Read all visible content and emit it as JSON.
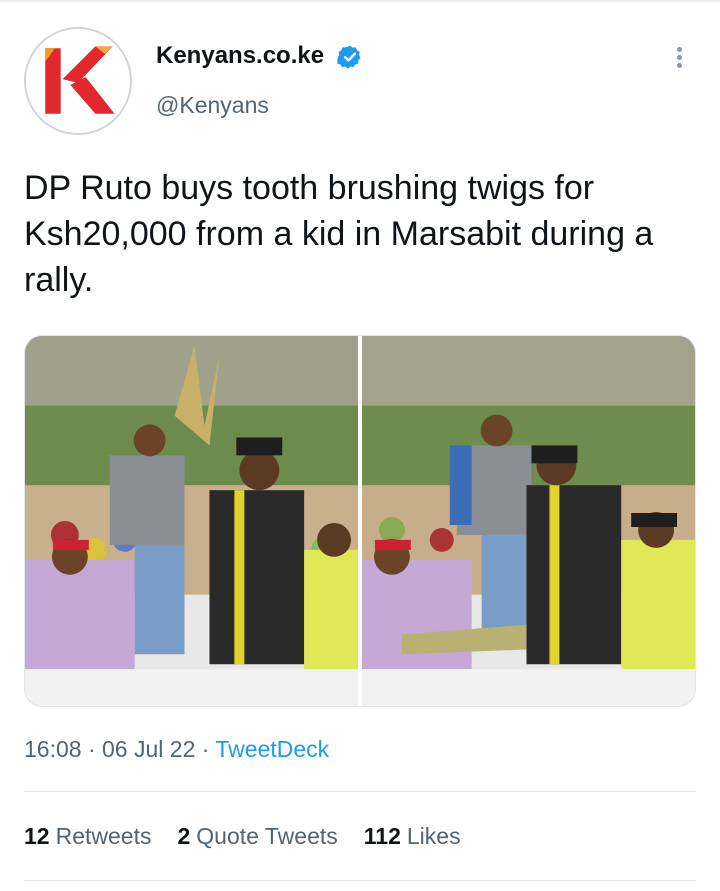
{
  "account": {
    "display_name": "Kenyans.co.ke",
    "handle": "@Kenyans",
    "verified": true,
    "avatar_logo": "K"
  },
  "tweet": {
    "text": "DP Ruto buys tooth brushing twigs for Ksh20,000 from a kid in Marsabit during a rally.",
    "time": "16:08",
    "date": "06 Jul 22",
    "source": "TweetDeck"
  },
  "stats": {
    "retweets_count": "12",
    "retweets_label": "Retweets",
    "quotes_count": "2",
    "quotes_label": "Quote Tweets",
    "likes_count": "112",
    "likes_label": "Likes"
  },
  "colors": {
    "accent": "#1d9bf0",
    "logo_red": "#e0282e",
    "logo_orange": "#f39b23",
    "verified": "#1d9bf0"
  },
  "icons": [
    "verified-badge-icon",
    "more-options-icon"
  ]
}
